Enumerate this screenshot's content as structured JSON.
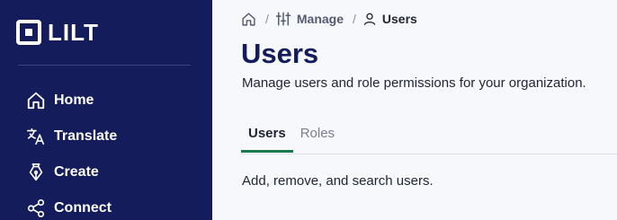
{
  "brand": {
    "name": "LILT"
  },
  "sidebar": {
    "items": [
      {
        "label": "Home",
        "icon": "home-icon"
      },
      {
        "label": "Translate",
        "icon": "translate-icon"
      },
      {
        "label": "Create",
        "icon": "pen-nib-icon"
      },
      {
        "label": "Connect",
        "icon": "share-nodes-icon"
      }
    ]
  },
  "breadcrumb": {
    "home_icon": "home-icon",
    "items": [
      {
        "label": "Manage",
        "icon": "sliders-icon"
      },
      {
        "label": "Users",
        "icon": "user-icon"
      }
    ],
    "separator": "/"
  },
  "page": {
    "title": "Users",
    "subtitle": "Manage users and role permissions for your organization."
  },
  "tabs": [
    {
      "label": "Users",
      "active": true
    },
    {
      "label": "Roles",
      "active": false
    }
  ],
  "panel": {
    "description": "Add, remove, and search users."
  },
  "colors": {
    "sidebar_bg": "#141c5c",
    "title": "#141c5c",
    "active_tab_underline": "#1b7a4b"
  }
}
